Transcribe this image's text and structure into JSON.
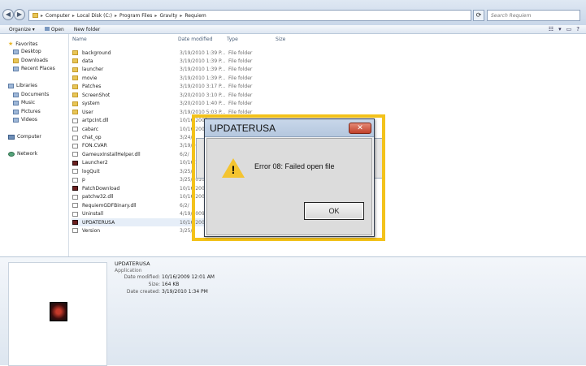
{
  "address": {
    "segments": [
      "Computer",
      "Local Disk (C:)",
      "Program Files",
      "Gravity",
      "Requiem"
    ]
  },
  "search": {
    "placeholder": "Search Requiem"
  },
  "toolbar": {
    "organize": "Organize ▾",
    "open": "Open",
    "new_folder": "New folder"
  },
  "nav": {
    "favorites": "Favorites",
    "desktop": "Desktop",
    "downloads": "Downloads",
    "recent": "Recent Places",
    "libraries": "Libraries",
    "documents": "Documents",
    "music": "Music",
    "pictures": "Pictures",
    "videos": "Videos",
    "computer": "Computer",
    "network": "Network"
  },
  "columns": {
    "name": "Name",
    "date": "Date modified",
    "type": "Type",
    "size": "Size"
  },
  "files": [
    {
      "name": "background",
      "date": "3/19/2010 1:39 P...",
      "type": "File folder",
      "icon": "folder"
    },
    {
      "name": "data",
      "date": "3/19/2010 1:39 P...",
      "type": "File folder",
      "icon": "folder"
    },
    {
      "name": "launcher",
      "date": "3/19/2010 1:39 P...",
      "type": "File folder",
      "icon": "folder"
    },
    {
      "name": "movie",
      "date": "3/19/2010 1:39 P...",
      "type": "File folder",
      "icon": "folder"
    },
    {
      "name": "Patches",
      "date": "3/19/2010 3:17 P...",
      "type": "File folder",
      "icon": "folder"
    },
    {
      "name": "ScreenShot",
      "date": "3/20/2010 3:10 P...",
      "type": "File folder",
      "icon": "folder"
    },
    {
      "name": "system",
      "date": "3/20/2010 1:40 P...",
      "type": "File folder",
      "icon": "folder"
    },
    {
      "name": "User",
      "date": "3/19/2010 5:03 P...",
      "type": "File folder",
      "icon": "folder"
    },
    {
      "name": "artpcInt.dll",
      "date": "10/16/2009",
      "type": "",
      "icon": "file"
    },
    {
      "name": "cabarc",
      "date": "10/16/2009",
      "type": "",
      "icon": "file"
    },
    {
      "name": "chat_op",
      "date": "3/24/",
      "type": "",
      "icon": "file"
    },
    {
      "name": "FON.CVAR",
      "date": "3/19/2010",
      "type": "",
      "icon": "file"
    },
    {
      "name": "GameuxInstallHelper.dll",
      "date": "6/2/",
      "type": "",
      "icon": "file"
    },
    {
      "name": "Launcher2",
      "date": "10/16/2009",
      "type": "",
      "icon": "app"
    },
    {
      "name": "logQuit",
      "date": "3/25/",
      "type": "",
      "icon": "file"
    },
    {
      "name": "p",
      "date": "3/25/2010",
      "type": "",
      "icon": "file"
    },
    {
      "name": "PatchDownload",
      "date": "10/16/2009",
      "type": "",
      "icon": "app"
    },
    {
      "name": "patchw32.dll",
      "date": "10/16/2009",
      "type": "",
      "icon": "file"
    },
    {
      "name": "RequiemGDFBinary.dll",
      "date": "6/2/",
      "type": "",
      "icon": "file"
    },
    {
      "name": "Uninstall",
      "date": "4/19/2009",
      "type": "",
      "icon": "file"
    },
    {
      "name": "UPDATERUSA",
      "date": "10/16/2009",
      "type": "",
      "icon": "app"
    },
    {
      "name": "Version",
      "date": "3/25/",
      "type": "",
      "icon": "file"
    }
  ],
  "details": {
    "name": "UPDATERUSA",
    "type": "Application",
    "modified_label": "Date modified:",
    "modified": "10/16/2009 12:01 AM",
    "size_label": "Size:",
    "size": "164 KB",
    "created_label": "Date created:",
    "created": "3/19/2010 1:34 PM"
  },
  "dialog": {
    "title": "UPDATERUSA",
    "message": "Error 08: Failed open file",
    "ok": "OK",
    "close": "✕"
  },
  "colors": {
    "highlight": "#f3c21b",
    "warning": "#f4c430",
    "close_button": "#c2412b"
  }
}
